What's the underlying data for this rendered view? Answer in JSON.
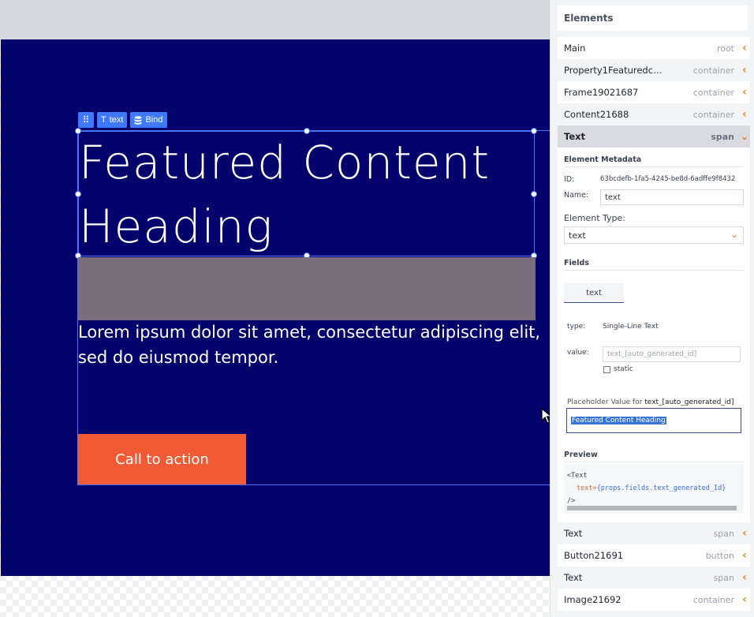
{
  "canvas": {
    "heading": "Featured Content Heading",
    "body": "Lorem ipsum dolor sit amet, consectetur adipiscing elit, sed do eiusmod tempor.",
    "cta_label": "Call to action",
    "colors": {
      "section_bg": "#03036b",
      "cta_bg": "#f05a35",
      "image_placeholder": "#7a6e7e",
      "selection": "#4a74ff"
    }
  },
  "toolbar": {
    "grip_icon": "drag-grip-icon",
    "text_label": "text",
    "text_icon": "text-type-icon",
    "bind_label": "Bind",
    "bind_icon": "database-icon"
  },
  "panel": {
    "title": "Elements",
    "tree_top": [
      {
        "name": "Main",
        "type": "root"
      },
      {
        "name": "Property1Featuredco...",
        "type": "container"
      },
      {
        "name": "Frame19021687",
        "type": "container"
      },
      {
        "name": "Content21688",
        "type": "container"
      }
    ],
    "selected": {
      "name": "Text",
      "type": "span"
    },
    "tree_bottom": [
      {
        "name": "Text",
        "type": "span"
      },
      {
        "name": "Button21691",
        "type": "button"
      },
      {
        "name": "Text",
        "type": "span"
      },
      {
        "name": "Image21692",
        "type": "container"
      }
    ],
    "metadata": {
      "section_title": "Element Metadata",
      "id_label": "ID:",
      "id_value": "63bcdefb-1fa5-4245-be8d-6adffe9f8432",
      "name_label": "Name:",
      "name_value": "text",
      "type_label": "Element Type:",
      "type_value": "text"
    },
    "fields": {
      "section_title": "Fields",
      "tab_label": "text",
      "type_label": "type:",
      "type_value": "Single-Line Text",
      "value_label": "value:",
      "value_placeholder": "text_[auto_generated_id]",
      "static_label": "static",
      "placeholder_label": "Placeholder Value for",
      "placeholder_key": "text_[auto_generated_id]",
      "placeholder_value": "Featured Content Heading"
    },
    "preview": {
      "section_title": "Preview",
      "line1": "<Text",
      "attr": "text=",
      "value": "{props.fields.text_generated_Id}",
      "line3": "/>"
    }
  }
}
